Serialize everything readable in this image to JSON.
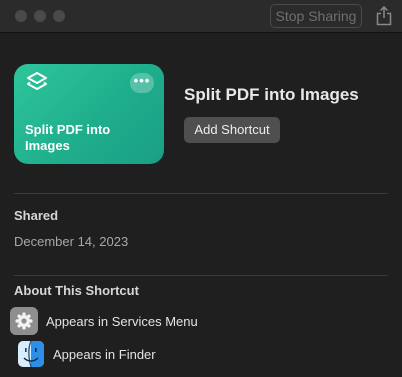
{
  "toolbar": {
    "stop_sharing_label": "Stop Sharing",
    "share_icon": "share-icon"
  },
  "card": {
    "title": "Split PDF into Images",
    "icon": "layers-icon",
    "more_label": "•••",
    "accent_color": "#23b894"
  },
  "header": {
    "title": "Split PDF into Images",
    "add_button_label": "Add Shortcut"
  },
  "shared": {
    "heading": "Shared",
    "date": "December 14, 2023"
  },
  "about": {
    "heading": "About This Shortcut",
    "items": [
      {
        "label": "Appears in Services Menu",
        "icon": "gear-icon"
      },
      {
        "label": "Appears in Finder",
        "icon": "finder-icon"
      }
    ]
  }
}
